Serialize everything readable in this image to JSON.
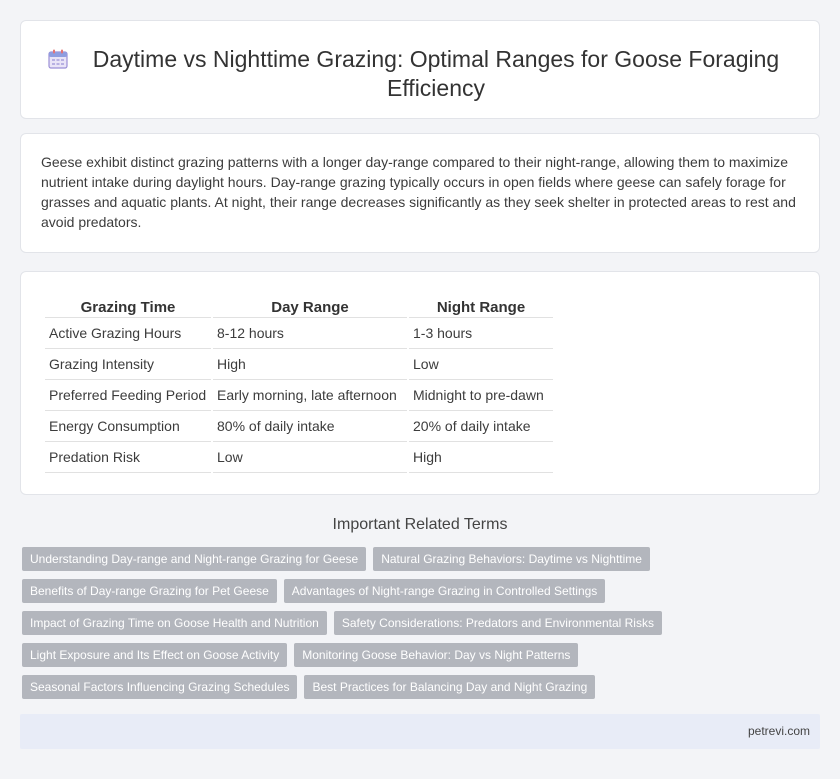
{
  "header": {
    "title": "Daytime vs Nighttime Grazing: Optimal Ranges for Goose Foraging Efficiency",
    "icon": "calendar-icon"
  },
  "intro": {
    "text": "Geese exhibit distinct grazing patterns with a longer day-range compared to their night-range, allowing them to maximize nutrient intake during daylight hours. Day-range grazing typically occurs in open fields where geese can safely forage for grasses and aquatic plants. At night, their range decreases significantly as they seek shelter in protected areas to rest and avoid predators."
  },
  "table": {
    "headers": [
      "Grazing Time",
      "Day Range",
      "Night Range"
    ],
    "rows": [
      [
        "Active Grazing Hours",
        "8-12 hours",
        "1-3 hours"
      ],
      [
        "Grazing Intensity",
        "High",
        "Low"
      ],
      [
        "Preferred Feeding Period",
        "Early morning, late afternoon",
        "Midnight to pre-dawn"
      ],
      [
        "Energy Consumption",
        "80% of daily intake",
        "20% of daily intake"
      ],
      [
        "Predation Risk",
        "Low",
        "High"
      ]
    ]
  },
  "related": {
    "title": "Important Related Terms",
    "rows": [
      [
        "Understanding Day-range and Night-range Grazing for Geese",
        "Natural Grazing Behaviors: Daytime vs Nighttime"
      ],
      [
        "Benefits of Day-range Grazing for Pet Geese",
        "Advantages of Night-range Grazing in Controlled Settings"
      ],
      [
        "Impact of Grazing Time on Goose Health and Nutrition",
        "Safety Considerations: Predators and Environmental Risks"
      ],
      [
        "Light Exposure and Its Effect on Goose Activity",
        "Monitoring Goose Behavior: Day vs Night Patterns"
      ],
      [
        "Seasonal Factors Influencing Grazing Schedules",
        "Best Practices for Balancing Day and Night Grazing"
      ]
    ]
  },
  "footer": {
    "site": "petrevi.com"
  }
}
